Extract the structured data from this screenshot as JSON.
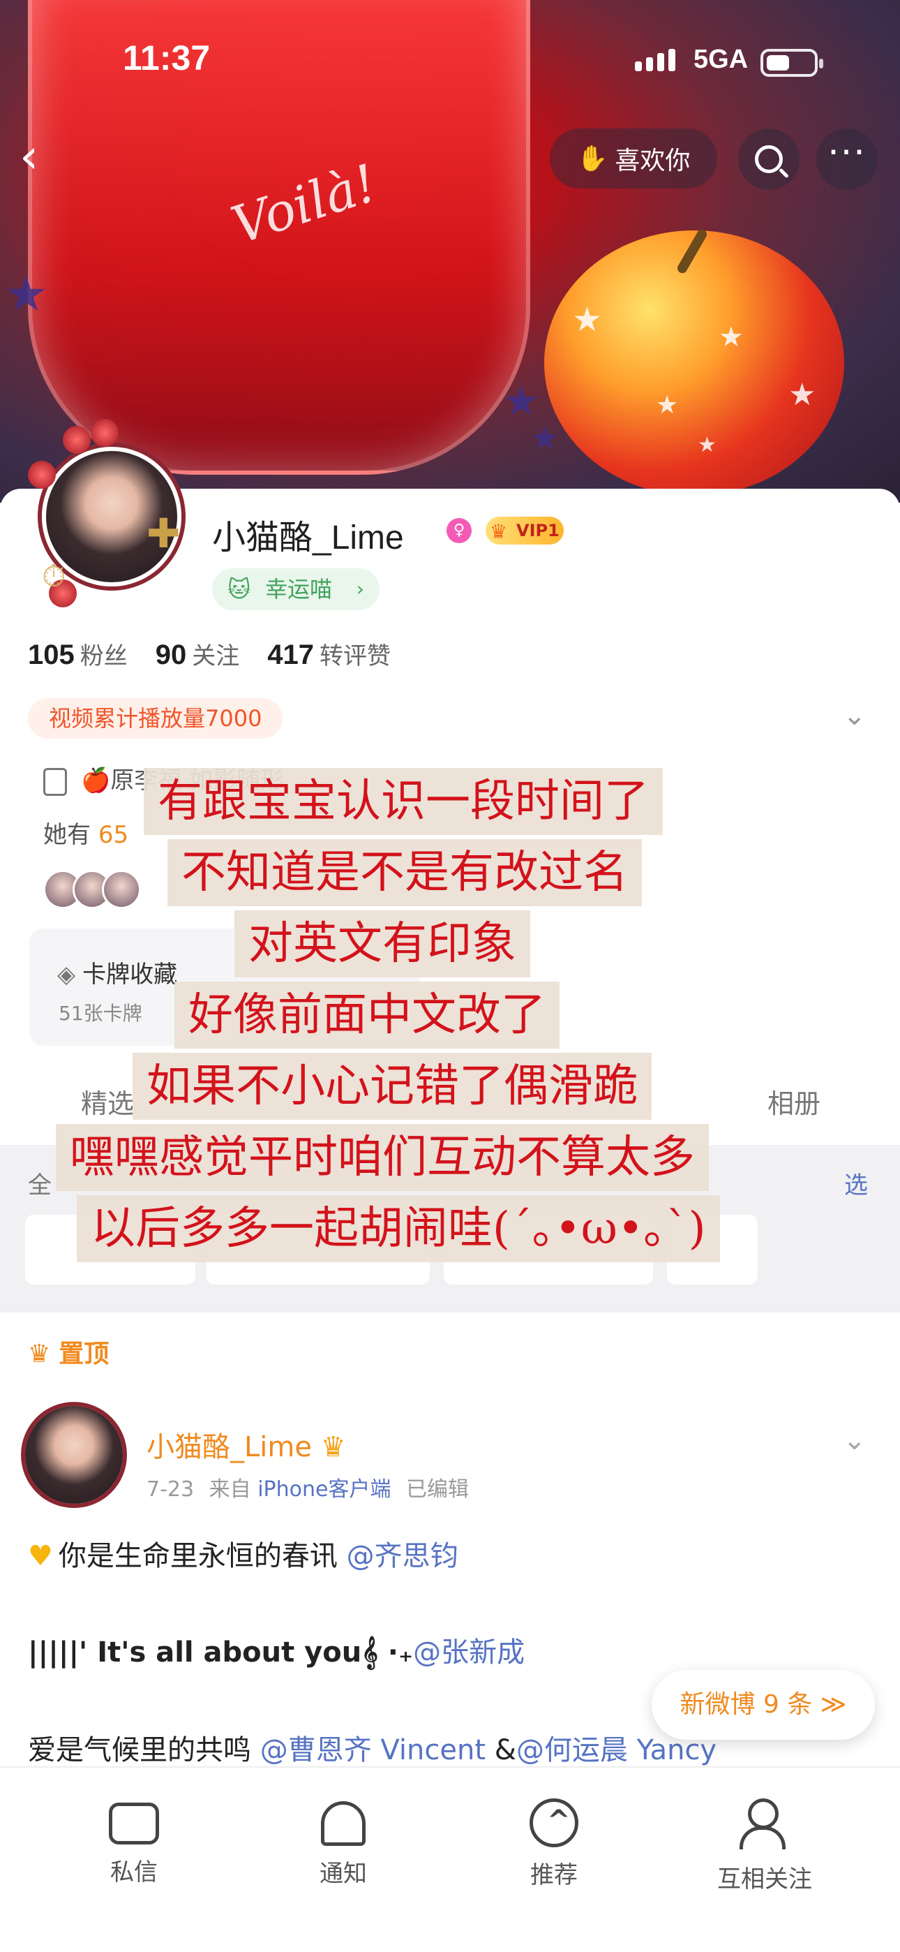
{
  "status_bar": {
    "time": "11:37",
    "network": "5GA"
  },
  "cover": {
    "glass_text": "Voilà!"
  },
  "nav": {
    "back_icon": "chevron-left-icon",
    "like_label": "喜欢你"
  },
  "profile": {
    "name": "小猫酪_Lime",
    "badge_vip": "VIP1",
    "lucky_label": "幸运喵",
    "stats": [
      {
        "num": "105",
        "label": "粉丝"
      },
      {
        "num": "90",
        "label": "关注"
      },
      {
        "num": "417",
        "label": "转评赞"
      }
    ],
    "video_badge": "视频累计播放量7000",
    "bio_prefix": "🍎原李福 如影随形",
    "followers_prefix": "她有 ",
    "followers_highlight": "65",
    "card_collection": {
      "title": "卡牌收藏",
      "sub": "51张卡牌"
    }
  },
  "tabs": [
    "精选",
    "相册"
  ],
  "filter": {
    "left": "全",
    "right": "选"
  },
  "note_lines": [
    "有跟宝宝认识一段时间了",
    "不知道是不是有改过名",
    "对英文有印象",
    "好像前面中文改了",
    "如果不小心记错了偶滑跪",
    "嘿嘿感觉平时咱们互动不算太多",
    "以后多多一起胡闹哇(´｡•ω•｡`)"
  ],
  "post": {
    "pinned_label": "置顶",
    "author": "小猫酪_Lime",
    "date": "7-23",
    "from_prefix": "来自",
    "source": "iPhone客户端",
    "edited": "已编辑",
    "line1_text": "你是生命里永恒的春讯",
    "line1_at": "@齐思钧",
    "line2_text": "|||||' It's all about you𝄞 ·₊",
    "line2_at": "@张新成",
    "line3_text": "爱是气候里的共鸣",
    "line3_at1": "@曹恩齐 Vincent",
    "line3_amp": " &",
    "line3_at2": "@何运晨 Yancy"
  },
  "fab": {
    "label": "新微博 9 条 ≫"
  },
  "bottom_nav": [
    {
      "label": "私信",
      "icon": "message-icon"
    },
    {
      "label": "通知",
      "icon": "bell-icon"
    },
    {
      "label": "推荐",
      "icon": "recommend-icon"
    },
    {
      "label": "互相关注",
      "icon": "mutual-follow-icon"
    }
  ]
}
